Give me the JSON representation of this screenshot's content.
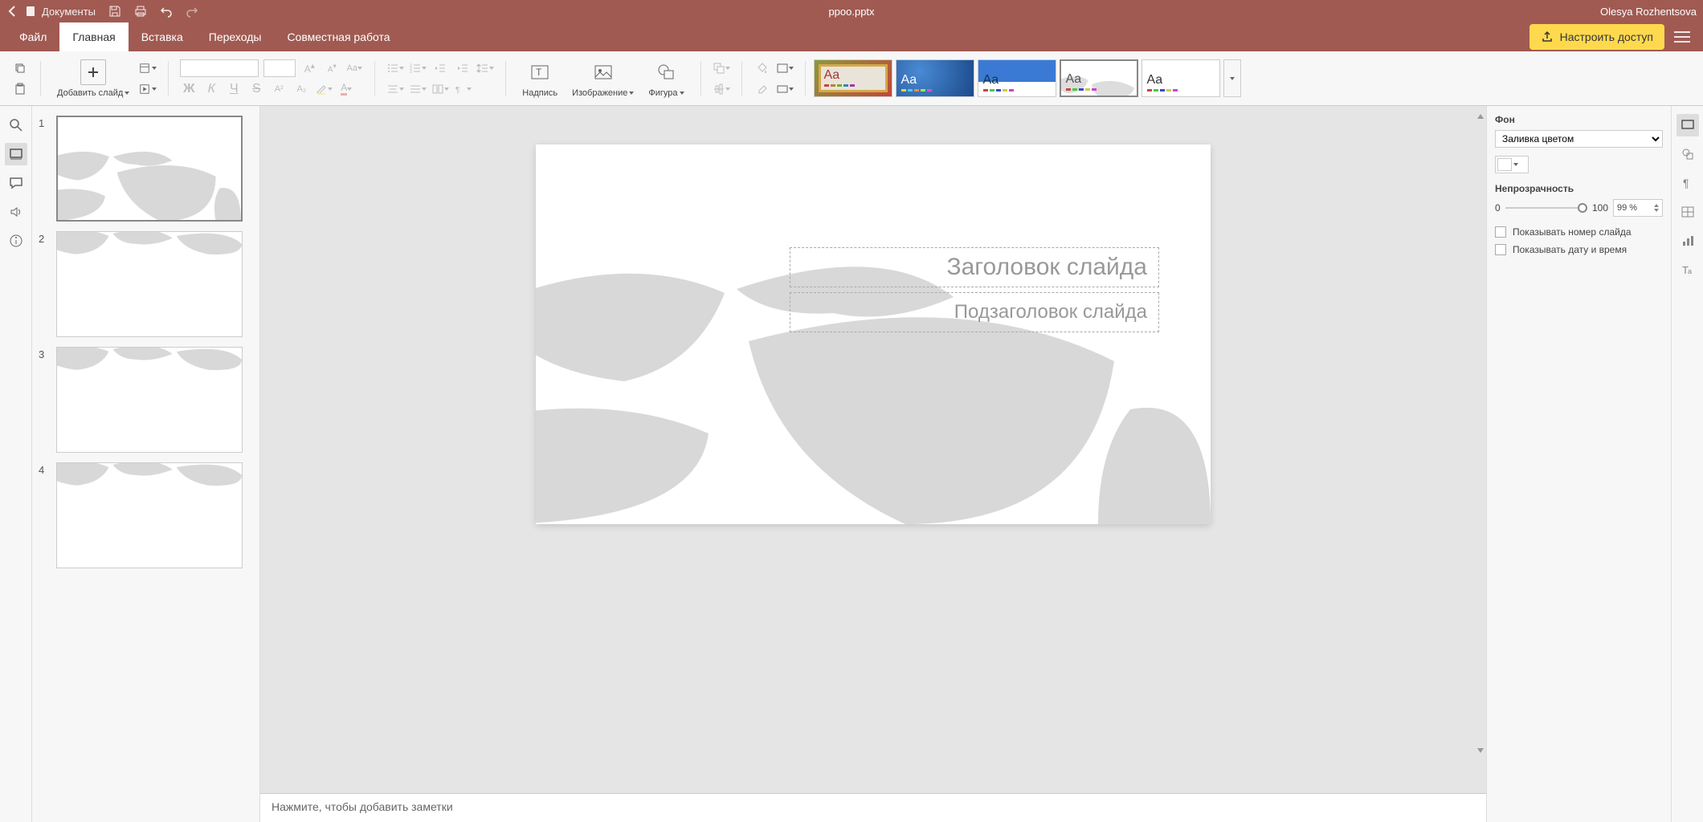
{
  "titlebar": {
    "app_label": "Документы",
    "doc_title": "ppoo.pptx",
    "user": "Olesya Rozhentsova"
  },
  "tabs": {
    "file": "Файл",
    "home": "Главная",
    "insert": "Вставка",
    "transitions": "Переходы",
    "collab": "Совместная работа"
  },
  "actions": {
    "share": "Настроить доступ"
  },
  "ribbon": {
    "add_slide": "Добавить слайд",
    "text_box": "Надпись",
    "image": "Изображение",
    "shape": "Фигура"
  },
  "themes": {
    "sample": "Aa"
  },
  "slides": {
    "thumbs": [
      1,
      2,
      3,
      4
    ]
  },
  "canvas": {
    "title_placeholder": "Заголовок слайда",
    "subtitle_placeholder": "Подзаголовок слайда"
  },
  "notes": {
    "placeholder": "Нажмите, чтобы добавить заметки"
  },
  "props": {
    "background_label": "Фон",
    "fill_option": "Заливка цветом",
    "opacity_label": "Непрозрачность",
    "opacity_min": "0",
    "opacity_max": "100",
    "opacity_value": "99 %",
    "show_number": "Показывать номер слайда",
    "show_date": "Показывать дату и время"
  }
}
